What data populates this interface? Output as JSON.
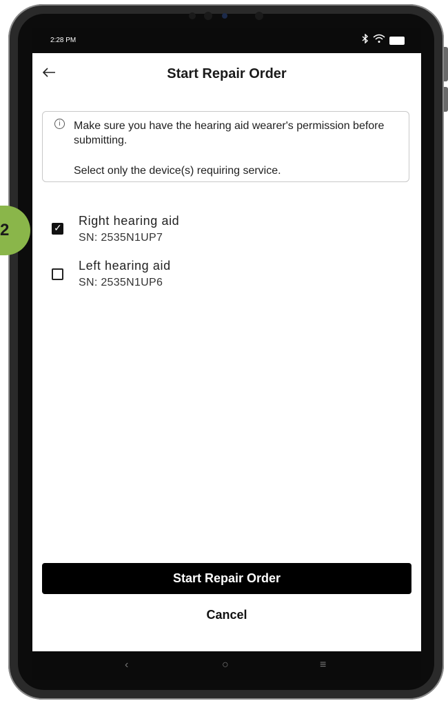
{
  "status_bar": {
    "time": "2:28 PM",
    "icons": [
      "bluetooth-icon",
      "wifi-icon",
      "battery-icon"
    ]
  },
  "header": {
    "title": "Start Repair Order",
    "back_icon": "back-arrow-icon"
  },
  "info": {
    "line1": "Make sure you have the hearing aid wearer's permission before submitting.",
    "line2": "Select only the device(s) requiring service."
  },
  "devices": [
    {
      "name": "Right hearing aid",
      "sn": "SN: 2535N1UP7",
      "checked": true
    },
    {
      "name": "Left hearing aid",
      "sn": "SN: 2535N1UP6",
      "checked": false
    }
  ],
  "actions": {
    "primary": "Start Repair Order",
    "cancel": "Cancel"
  },
  "step_badge": {
    "number": "2",
    "color": "#8ab64a"
  },
  "nav": {
    "back": "‹",
    "home": "○",
    "menu": "≡"
  }
}
